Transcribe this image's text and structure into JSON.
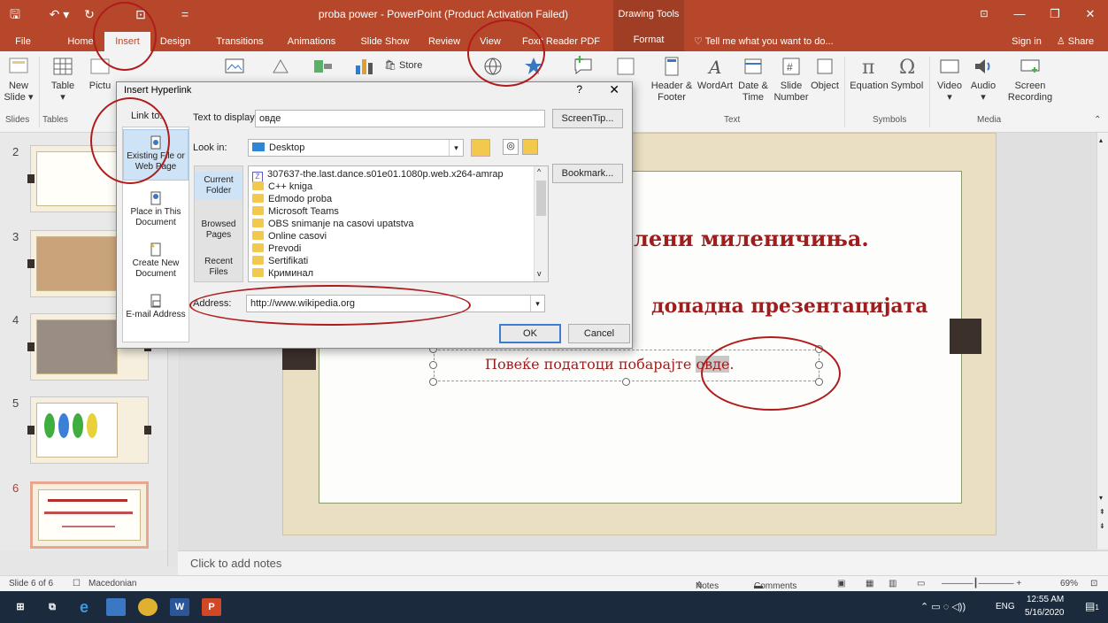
{
  "window": {
    "title": "proba power - PowerPoint (Product Activation Failed)",
    "context_tab_group": "Drawing Tools",
    "qat_save": "🖫",
    "qat_undo": "↶ ▾",
    "qat_redo": "↻",
    "qat_custom": "⊡",
    "qat_more": "=",
    "min": "—",
    "restore": "❐",
    "close": "✕",
    "ribbon_display": "⊡"
  },
  "tabs": [
    "File",
    "Home",
    "Insert",
    "Design",
    "Transitions",
    "Animations",
    "Slide Show",
    "Review",
    "View",
    "Foxit Reader PDF",
    "Format"
  ],
  "tell_me": "Tell me what you want to do...",
  "sign_in": "Sign in",
  "share": "Share",
  "ribbon": {
    "new_slide": "New Slide",
    "table": "Table",
    "pictures": "Pictu",
    "store": "Store",
    "header_footer": "Header & Footer",
    "wordart": "WordArt",
    "date_time": "Date & Time",
    "slide_number": "Slide Number",
    "object": "Object",
    "equation": "Equation",
    "symbol": "Symbol",
    "video": "Video",
    "audio": "Audio",
    "screen_recording": "Screen Recording",
    "text_box_frag": "xt",
    "text_box_frag2": "x",
    "groups": {
      "slides": "Slides",
      "tables": "Tables",
      "text": "Text",
      "symbols": "Symbols",
      "media": "Media"
    }
  },
  "slides": {
    "numbers": [
      "2",
      "3",
      "4",
      "5",
      "6"
    ]
  },
  "slide": {
    "title": "лени миленичиња.",
    "subtitle": "допадна презентацијата",
    "line": "Повеќе податоци побарајте",
    "link_word": "овде",
    "period": "."
  },
  "notes_placeholder": "Click to add notes",
  "status": {
    "slide_info": "Slide 6 of 6",
    "language": "Macedonian",
    "notes": "Notes",
    "comments": "Comments",
    "zoom": "69%"
  },
  "taskbar": {
    "lang": "ENG",
    "time": "12:55 AM",
    "date": "5/16/2020",
    "notif_count": "1"
  },
  "dialog": {
    "title": "Insert Hyperlink",
    "help": "?",
    "close": "✕",
    "link_to": "Link to:",
    "link_options": [
      "Existing File or Web Page",
      "Place in This Document",
      "Create New Document",
      "E-mail Address"
    ],
    "text_to_display_label": "Text to display:",
    "text_to_display": "овде",
    "screentip": "ScreenTip...",
    "look_in_label": "Look in:",
    "look_in": "Desktop",
    "nav": [
      "Current Folder",
      "Browsed Pages",
      "Recent Files"
    ],
    "bookmark": "Bookmark...",
    "files": [
      "307637-the.last.dance.s01e01.1080p.web.x264-amrap",
      "C++ kniga",
      "Edmodo proba",
      "Microsoft Teams",
      "OBS snimanje na casovi upatstva",
      "Online casovi",
      "Prevodi",
      "Sertifikati",
      "Криминал"
    ],
    "address_label": "Address:",
    "address": "http://www.wikipedia.org",
    "ok": "OK",
    "cancel": "Cancel"
  }
}
